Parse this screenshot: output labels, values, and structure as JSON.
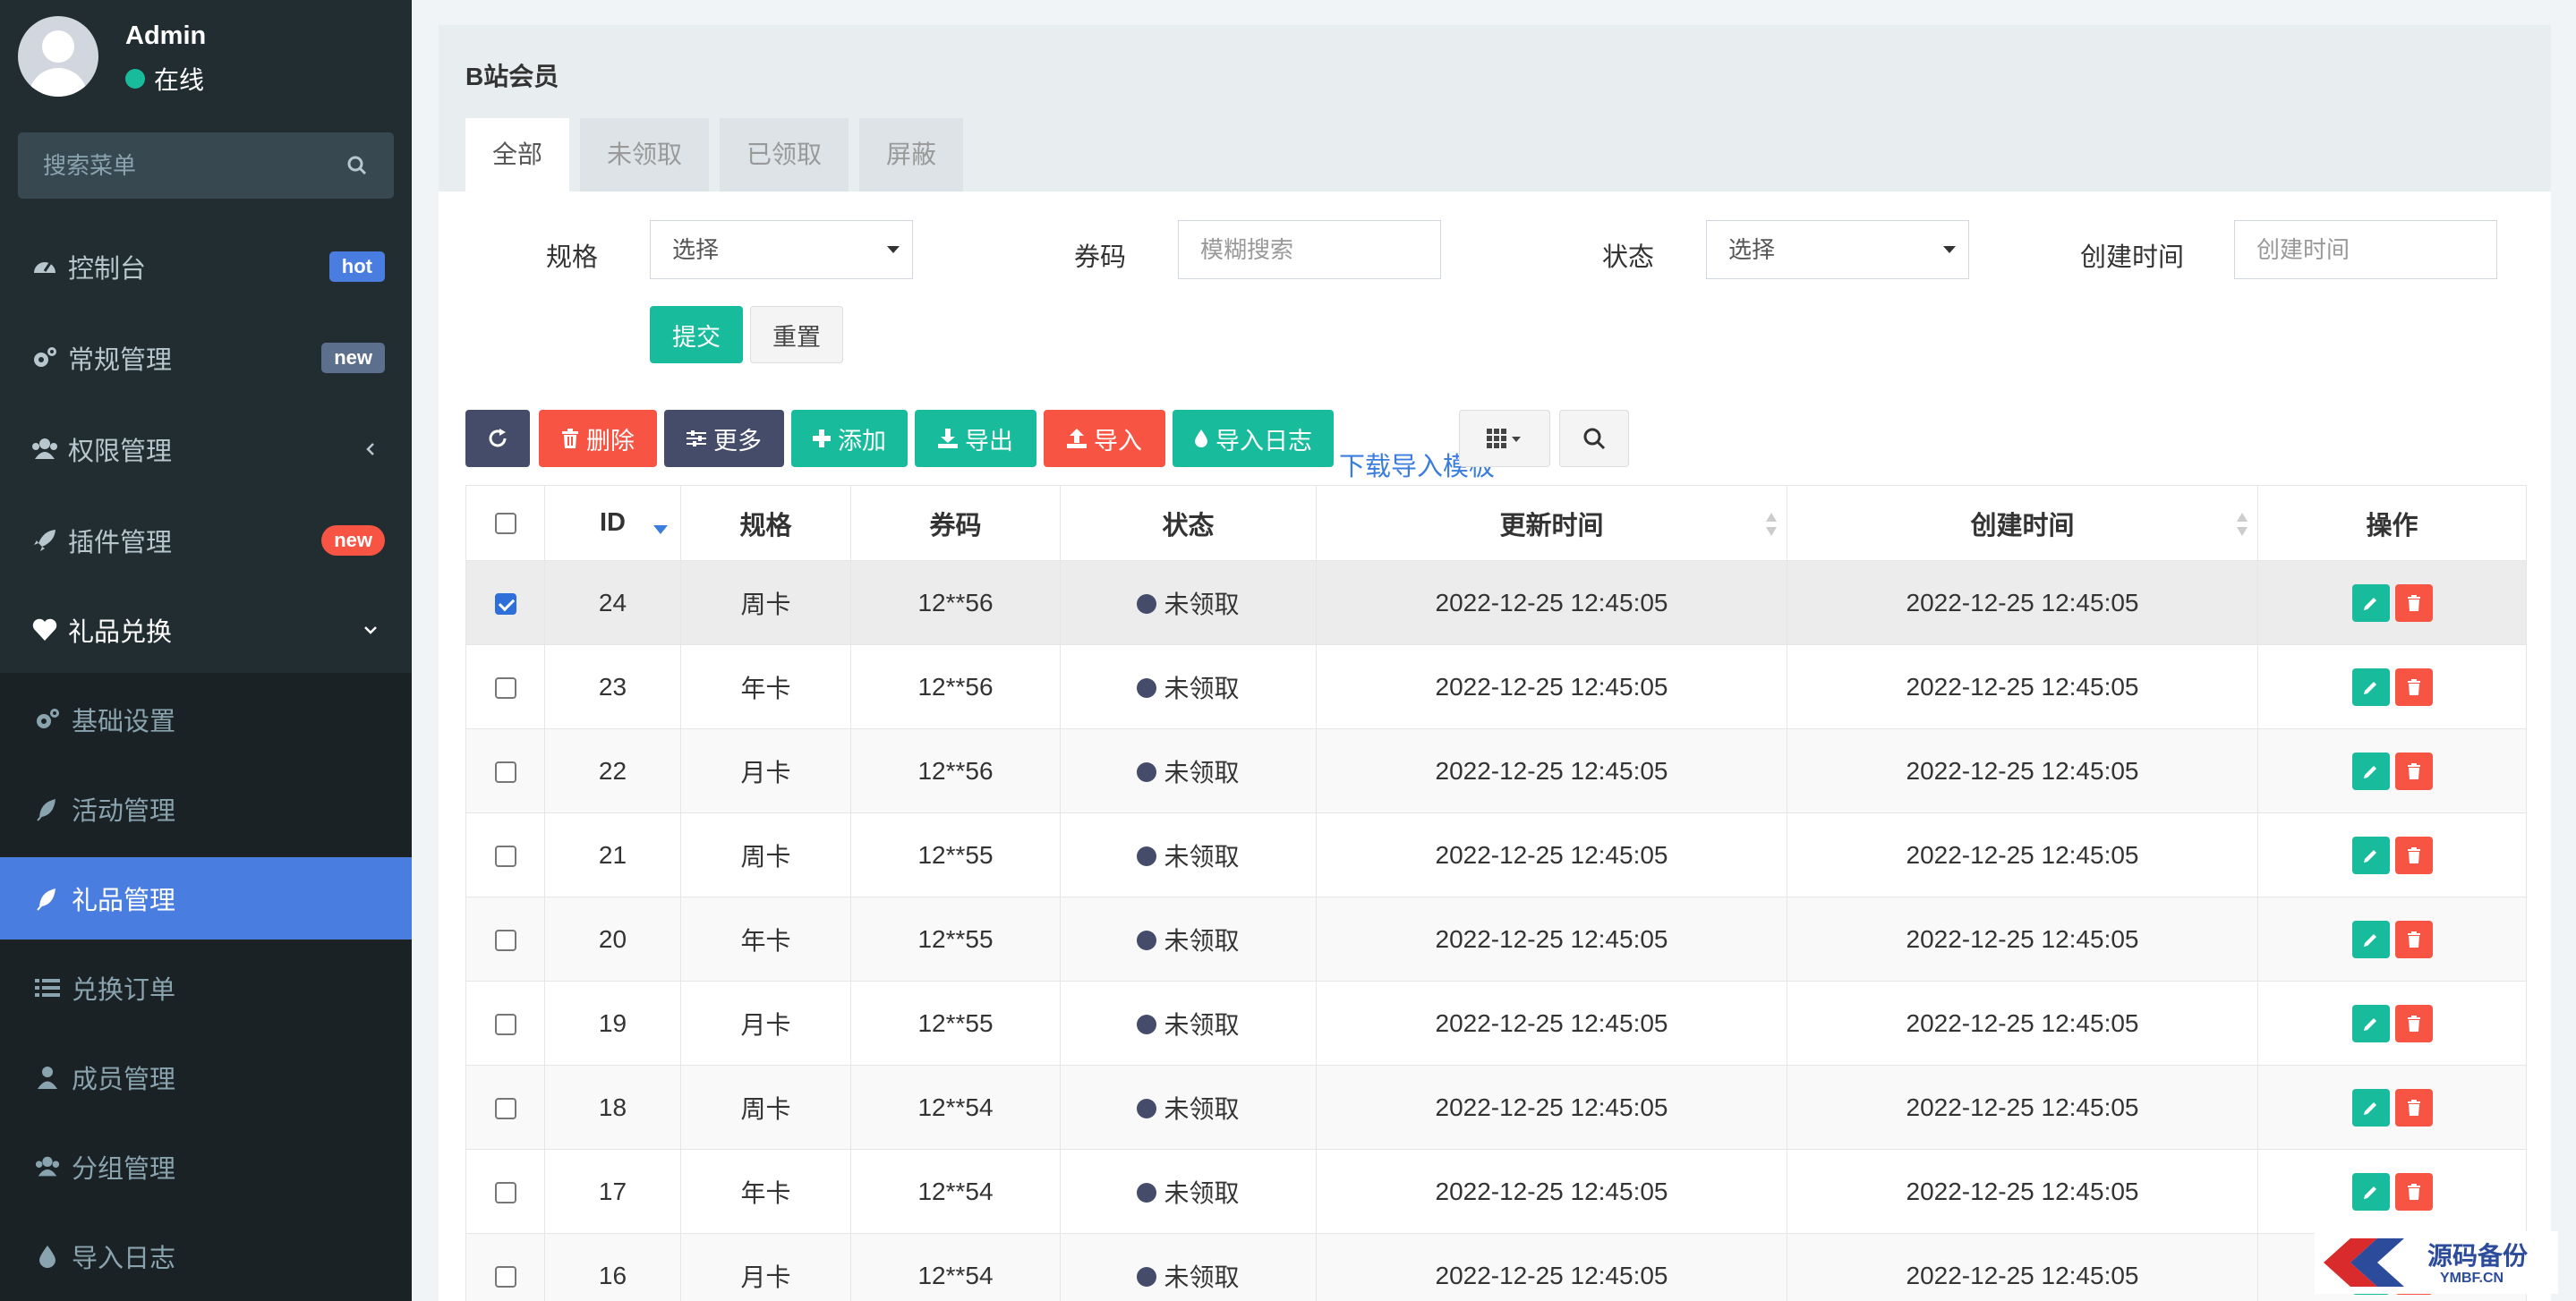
{
  "user": {
    "name": "Admin",
    "status": "在线"
  },
  "sidebar": {
    "search_placeholder": "搜索菜单",
    "items": [
      {
        "label": "控制台",
        "icon": "dashboard-icon",
        "badge": "hot"
      },
      {
        "label": "常规管理",
        "icon": "cogs-icon",
        "badge": "new"
      },
      {
        "label": "权限管理",
        "icon": "users-icon",
        "badge": ""
      },
      {
        "label": "插件管理",
        "icon": "rocket-icon",
        "badge": "new"
      },
      {
        "label": "礼品兑换",
        "icon": "heart-icon",
        "badge": ""
      }
    ],
    "subitems": [
      {
        "label": "基础设置",
        "icon": "cogs-icon"
      },
      {
        "label": "活动管理",
        "icon": "leaf-icon"
      },
      {
        "label": "礼品管理",
        "icon": "leaf-icon",
        "active": true
      },
      {
        "label": "兑换订单",
        "icon": "list-icon"
      },
      {
        "label": "成员管理",
        "icon": "user-icon"
      },
      {
        "label": "分组管理",
        "icon": "users-icon"
      },
      {
        "label": "导入日志",
        "icon": "tint-icon"
      }
    ]
  },
  "panel": {
    "title": "B站会员",
    "tabs": [
      "全部",
      "未领取",
      "已领取",
      "屏蔽"
    ],
    "active_tab": "全部"
  },
  "filters": {
    "spec_label": "规格",
    "spec_value": "选择",
    "code_label": "券码",
    "code_placeholder": "模糊搜索",
    "status_label": "状态",
    "status_value": "选择",
    "created_label": "创建时间",
    "created_placeholder": "创建时间",
    "submit": "提交",
    "reset": "重置"
  },
  "toolbar": {
    "delete": "删除",
    "more": "更多",
    "add": "添加",
    "export": "导出",
    "import": "导入",
    "import_log": "导入日志",
    "download_template": "下载导入模板"
  },
  "table": {
    "columns": [
      "ID",
      "规格",
      "券码",
      "状态",
      "更新时间",
      "创建时间",
      "操作"
    ],
    "rows": [
      {
        "id": "24",
        "spec": "周卡",
        "code": "12**56",
        "status": "未领取",
        "updated": "2022-12-25 12:45:05",
        "created": "2022-12-25 12:45:05",
        "checked": true
      },
      {
        "id": "23",
        "spec": "年卡",
        "code": "12**56",
        "status": "未领取",
        "updated": "2022-12-25 12:45:05",
        "created": "2022-12-25 12:45:05",
        "checked": false
      },
      {
        "id": "22",
        "spec": "月卡",
        "code": "12**56",
        "status": "未领取",
        "updated": "2022-12-25 12:45:05",
        "created": "2022-12-25 12:45:05",
        "checked": false
      },
      {
        "id": "21",
        "spec": "周卡",
        "code": "12**55",
        "status": "未领取",
        "updated": "2022-12-25 12:45:05",
        "created": "2022-12-25 12:45:05",
        "checked": false
      },
      {
        "id": "20",
        "spec": "年卡",
        "code": "12**55",
        "status": "未领取",
        "updated": "2022-12-25 12:45:05",
        "created": "2022-12-25 12:45:05",
        "checked": false
      },
      {
        "id": "19",
        "spec": "月卡",
        "code": "12**55",
        "status": "未领取",
        "updated": "2022-12-25 12:45:05",
        "created": "2022-12-25 12:45:05",
        "checked": false
      },
      {
        "id": "18",
        "spec": "周卡",
        "code": "12**54",
        "status": "未领取",
        "updated": "2022-12-25 12:45:05",
        "created": "2022-12-25 12:45:05",
        "checked": false
      },
      {
        "id": "17",
        "spec": "年卡",
        "code": "12**54",
        "status": "未领取",
        "updated": "2022-12-25 12:45:05",
        "created": "2022-12-25 12:45:05",
        "checked": false
      },
      {
        "id": "16",
        "spec": "月卡",
        "code": "12**54",
        "status": "未领取",
        "updated": "2022-12-25 12:45:05",
        "created": "2022-12-25 12:45:05",
        "checked": false
      }
    ]
  },
  "watermark": {
    "title": "源码备份",
    "subtitle": "YMBF.CN"
  },
  "colors": {
    "sidebar": "#222d32",
    "active": "#4a7de0",
    "green": "#18bc9c",
    "red": "#f75444",
    "dark": "#444c69"
  }
}
